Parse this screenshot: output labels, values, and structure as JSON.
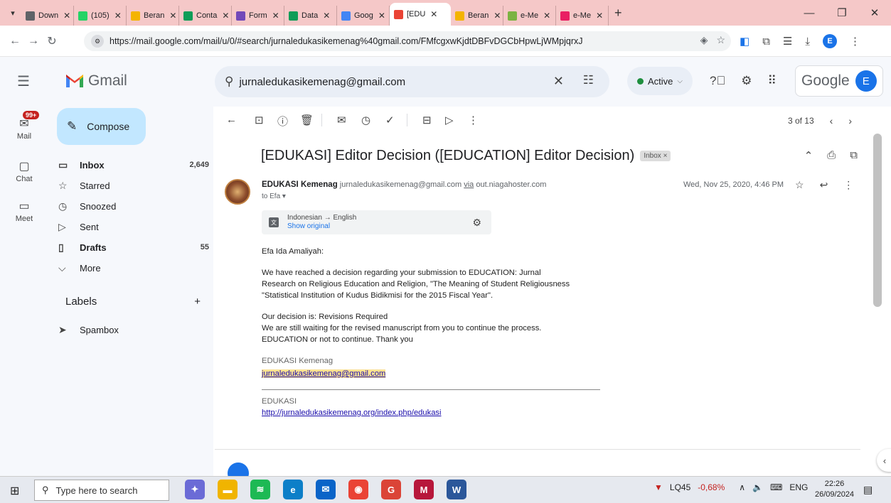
{
  "browser": {
    "tabs": [
      {
        "label": "Down",
        "favicon_color": "#5f6368",
        "favicon": "download-icon"
      },
      {
        "label": "(105)",
        "favicon_color": "#25d366",
        "favicon": "whatsapp-icon"
      },
      {
        "label": "Beran",
        "favicon_color": "#f4b400",
        "favicon": "grid-icon"
      },
      {
        "label": "Conta",
        "favicon_color": "#0f9d58",
        "favicon": "drive-icon"
      },
      {
        "label": "Form",
        "favicon_color": "#7248b9",
        "favicon": "forms-icon"
      },
      {
        "label": "Data",
        "favicon_color": "#0f9d58",
        "favicon": "sheets-icon"
      },
      {
        "label": "Goog",
        "favicon_color": "#4285f4",
        "favicon": "docs-icon"
      },
      {
        "label": "[EDU",
        "favicon_color": "#ea4335",
        "favicon": "gmail-icon",
        "active": true
      },
      {
        "label": "Beran",
        "favicon_color": "#f4b400",
        "favicon": "grid-icon"
      },
      {
        "label": "e-Me",
        "favicon_color": "#7cb342",
        "favicon": "check-icon"
      },
      {
        "label": "e-Me",
        "favicon_color": "#e91e63",
        "favicon": "grid-icon"
      }
    ],
    "url": "https://mail.google.com/mail/u/0/#search/jurnaledukasikemenag%40gmail.com/FMfcgxwKjdtDBFvDGCbHpwLjWMpjqrxJ",
    "profile_initial": "E"
  },
  "gmail": {
    "brand": "Gmail",
    "search_query": "jurnaledukasikemenag@gmail.com",
    "status": "Active",
    "google_label": "Google",
    "account_initial": "E"
  },
  "rail": {
    "mail_badge": "99+",
    "mail": "Mail",
    "chat": "Chat",
    "meet": "Meet"
  },
  "nav": {
    "compose": "Compose",
    "items": [
      {
        "label": "Inbox",
        "count": "2,649",
        "icon": "inbox-icon"
      },
      {
        "label": "Starred",
        "count": "",
        "icon": "star-icon"
      },
      {
        "label": "Snoozed",
        "count": "",
        "icon": "clock-icon"
      },
      {
        "label": "Sent",
        "count": "",
        "icon": "send-icon"
      },
      {
        "label": "Drafts",
        "count": "55",
        "icon": "draft-icon"
      },
      {
        "label": "More",
        "count": "",
        "icon": "chevron-down-icon"
      }
    ],
    "labels_title": "Labels",
    "labels": [
      {
        "label": "Spambox",
        "icon": "label-icon"
      }
    ]
  },
  "email": {
    "pager": "3 of 13",
    "subject": "[EDUKASI] Editor Decision ([EDUCATION] Editor Decision)",
    "chip": "Inbox ×",
    "sender_name": "EDUKASI Kemenag",
    "sender_email": "jurnaledukasikemenag@gmail.com",
    "via": "via",
    "via_host": "out.niagahoster.com",
    "to": "to Efa ▾",
    "date": "Wed, Nov 25, 2020, 4:46 PM",
    "translate": {
      "langs": "Indonesian → English",
      "show_original": "Show original"
    },
    "greeting": "Efa Ida Amaliyah:",
    "para1_l1": "We have reached a decision regarding your submission to EDUCATION: Jurnal",
    "para1_l2": "Research on Religious Education and Religion, \"The Meaning of Student Religiousness",
    "para1_l3": "\"Statistical Institution of Kudus Bidikmisi for the 2015 Fiscal Year\".",
    "para2_l1": "Our decision is: Revisions Required",
    "para2_l2": "We are still waiting for the revised manuscript from you to continue the process.",
    "para2_l3": "EDUCATION or not to continue. Thank you",
    "sig_name": "EDUKASI Kemenag",
    "sig_email": "jurnaledukasikemenag@gmail.com",
    "sig_org": "EDUKASI",
    "sig_link": "http://jurnaledukasikemenag.org/index.php/edukasi"
  },
  "taskbar": {
    "search_placeholder": "Type here to search",
    "stock": "LQ45",
    "stock_change": "-0,68%",
    "lang": "ENG",
    "time": "22:26",
    "date": "26/09/2024",
    "apps": [
      {
        "name": "copilot-icon",
        "color": "#6b6bd6",
        "glyph": "✦"
      },
      {
        "name": "file-explorer-icon",
        "color": "#f0b400",
        "glyph": "▬"
      },
      {
        "name": "spotify-icon",
        "color": "#1db954",
        "glyph": "≋"
      },
      {
        "name": "edge-icon",
        "color": "#0c7fc8",
        "glyph": "e"
      },
      {
        "name": "mail-app-icon",
        "color": "#0a64c8",
        "glyph": "✉"
      },
      {
        "name": "chrome-icon",
        "color": "#ea4335",
        "glyph": "◉"
      },
      {
        "name": "chrome-profile-icon",
        "color": "#db4437",
        "glyph": "G"
      },
      {
        "name": "app-icon",
        "color": "#b7173b",
        "glyph": "M"
      },
      {
        "name": "word-icon",
        "color": "#2b579a",
        "glyph": "W"
      }
    ]
  }
}
